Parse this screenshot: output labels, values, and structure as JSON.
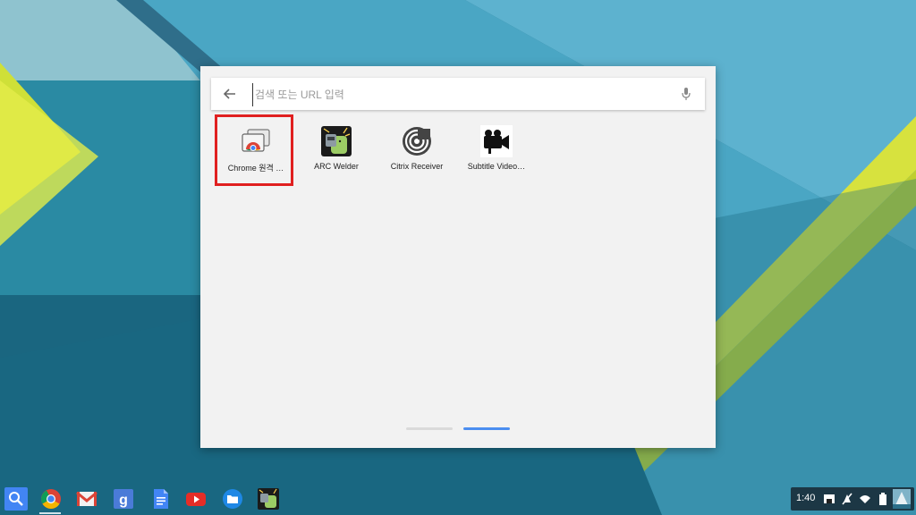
{
  "search": {
    "placeholder": "검색 또는 URL 입력"
  },
  "apps": [
    {
      "label": "Chrome 원격 …",
      "icon": "chrome-remote-desktop-icon"
    },
    {
      "label": "ARC Welder",
      "icon": "arc-welder-icon"
    },
    {
      "label": "Citrix Receiver",
      "icon": "citrix-receiver-icon"
    },
    {
      "label": "Subtitle Video…",
      "icon": "subtitle-video-icon"
    }
  ],
  "pagination": {
    "page_count": 2,
    "current_page": 2
  },
  "shelf": {
    "items": [
      {
        "icon": "launcher-search-icon"
      },
      {
        "icon": "chrome-icon"
      },
      {
        "icon": "gmail-icon"
      },
      {
        "icon": "google-search-icon"
      },
      {
        "icon": "docs-icon"
      },
      {
        "icon": "youtube-icon"
      },
      {
        "icon": "files-icon"
      },
      {
        "icon": "arc-welder-icon"
      }
    ]
  },
  "status": {
    "time": "1:40"
  },
  "colors": {
    "accent": "#4b8ef0",
    "highlight": "#e02020"
  }
}
